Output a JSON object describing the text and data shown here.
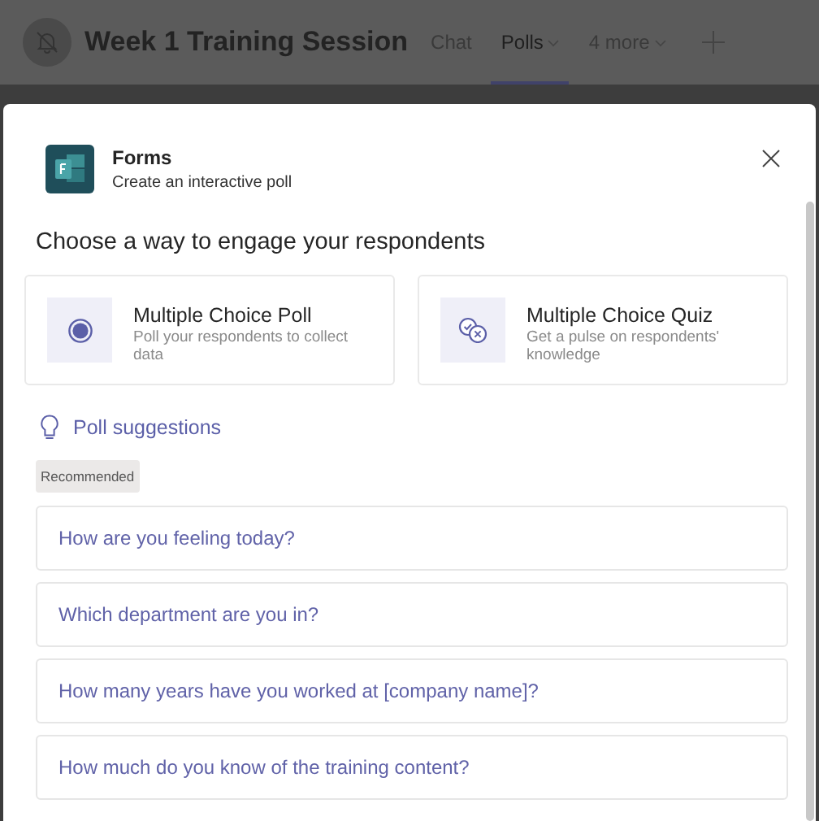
{
  "header": {
    "title": "Week 1 Training Session",
    "tabs": [
      {
        "label": "Chat",
        "selected": false,
        "dropdown": false
      },
      {
        "label": "Polls",
        "selected": true,
        "dropdown": true
      },
      {
        "label": "4 more",
        "selected": false,
        "dropdown": true
      }
    ]
  },
  "dialog": {
    "app_name": "Forms",
    "app_subtitle": "Create an interactive poll",
    "heading": "Choose a way to engage your respondents",
    "options": [
      {
        "kind": "poll",
        "title": "Multiple Choice Poll",
        "description": "Poll your respondents to collect data"
      },
      {
        "kind": "quiz",
        "title": "Multiple Choice Quiz",
        "description": "Get a pulse on respondents' knowledge"
      }
    ],
    "suggestions_title": "Poll suggestions",
    "badge": "Recommended",
    "suggestions": [
      "How are you feeling today?",
      "Which department are you in?",
      "How many years have you worked at [company name]?",
      "How much do you know of the training content?"
    ]
  }
}
